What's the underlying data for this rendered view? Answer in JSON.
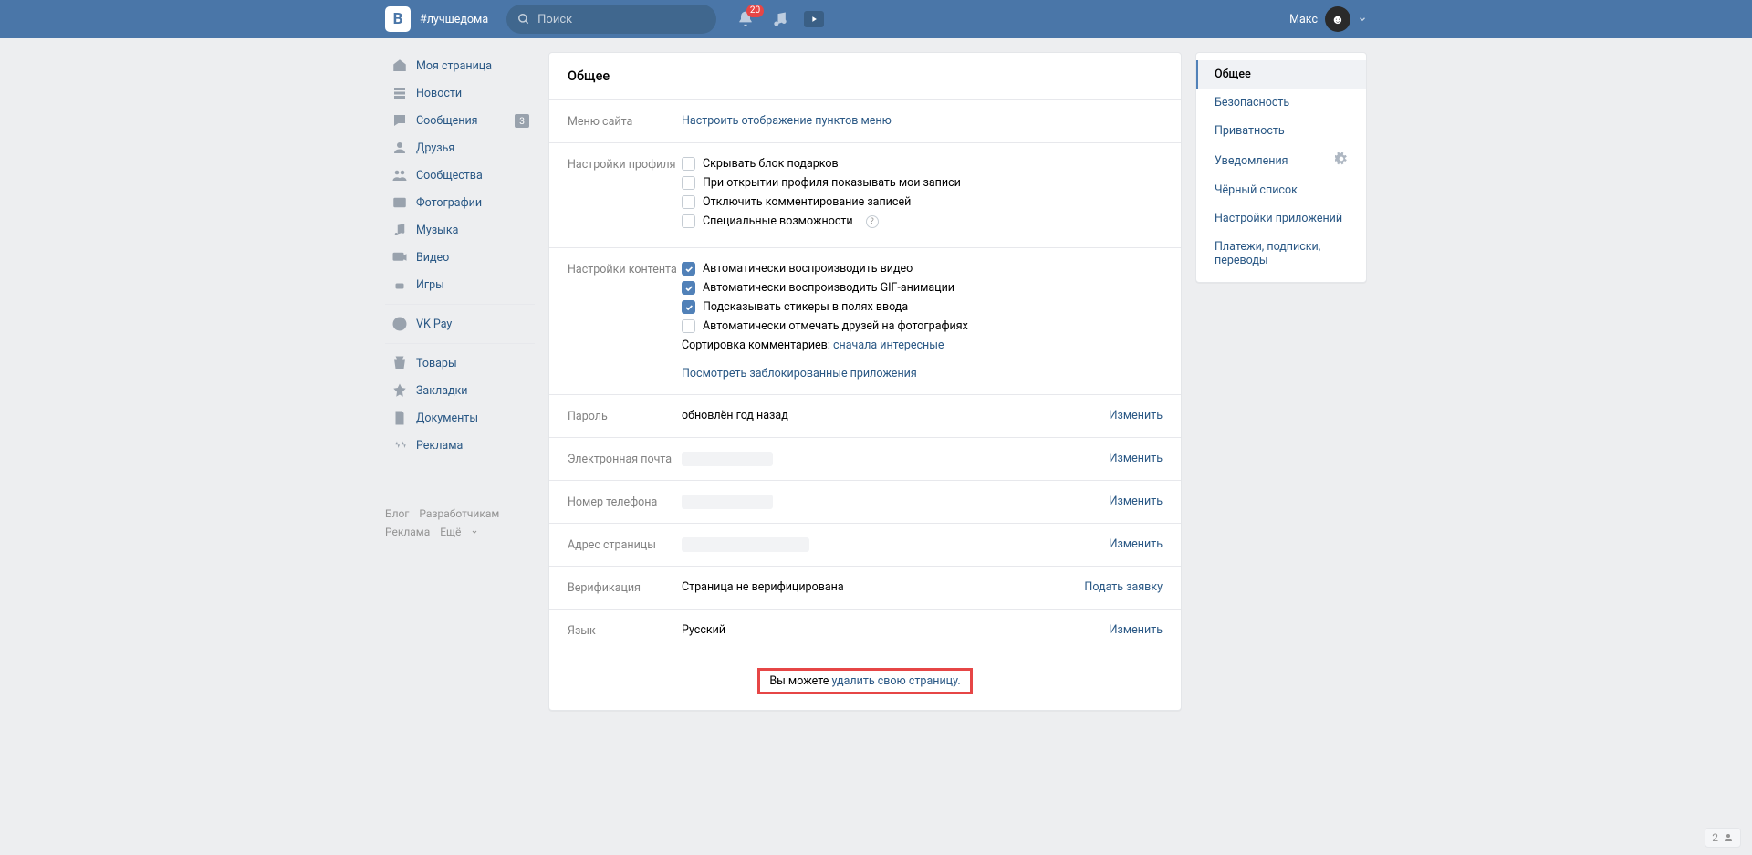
{
  "header": {
    "hashtag": "#лучшедома",
    "search_placeholder": "Поиск",
    "notif_count": "20",
    "username": "Макс"
  },
  "sidebar": {
    "items": [
      {
        "label": "Моя страница"
      },
      {
        "label": "Новости"
      },
      {
        "label": "Сообщения",
        "count": "3"
      },
      {
        "label": "Друзья"
      },
      {
        "label": "Сообщества"
      },
      {
        "label": "Фотографии"
      },
      {
        "label": "Музыка"
      },
      {
        "label": "Видео"
      },
      {
        "label": "Игры"
      }
    ],
    "vkpay": "VK Pay",
    "extra": [
      {
        "label": "Товары"
      },
      {
        "label": "Закладки"
      },
      {
        "label": "Документы"
      },
      {
        "label": "Реклама"
      }
    ],
    "footer": {
      "blog": "Блог",
      "devs": "Разработчикам",
      "ads": "Реклама",
      "more": "Ещё"
    }
  },
  "content": {
    "title": "Общее",
    "menu": {
      "label": "Меню сайта",
      "link": "Настроить отображение пунктов меню"
    },
    "profile": {
      "label": "Настройки профиля",
      "opts": [
        {
          "text": "Скрывать блок подарков",
          "checked": false
        },
        {
          "text": "При открытии профиля показывать мои записи",
          "checked": false
        },
        {
          "text": "Отключить комментирование записей",
          "checked": false
        },
        {
          "text": "Специальные возможности",
          "checked": false,
          "help": true
        }
      ]
    },
    "content_set": {
      "label": "Настройки контента",
      "opts": [
        {
          "text": "Автоматически воспроизводить видео",
          "checked": true
        },
        {
          "text": "Автоматически воспроизводить GIF-анимации",
          "checked": true
        },
        {
          "text": "Подсказывать стикеры в полях ввода",
          "checked": true
        },
        {
          "text": "Автоматически отмечать друзей на фотографиях",
          "checked": false
        }
      ],
      "sort_label": "Сортировка комментариев: ",
      "sort_value": "сначала интересные",
      "blocked": "Посмотреть заблокированные приложения"
    },
    "password": {
      "label": "Пароль",
      "value": "обновлён год назад",
      "action": "Изменить"
    },
    "email": {
      "label": "Электронная почта",
      "action": "Изменить"
    },
    "phone": {
      "label": "Номер телефона",
      "action": "Изменить"
    },
    "address": {
      "label": "Адрес страницы",
      "action": "Изменить"
    },
    "verify": {
      "label": "Верификация",
      "value": "Страница не верифицирована",
      "action": "Подать заявку"
    },
    "lang": {
      "label": "Язык",
      "value": "Русский",
      "action": "Изменить"
    },
    "delete": {
      "prefix": "Вы можете ",
      "link": "удалить свою страницу."
    }
  },
  "tabs": [
    {
      "label": "Общее",
      "active": true
    },
    {
      "label": "Безопасность"
    },
    {
      "label": "Приватность"
    },
    {
      "label": "Уведомления",
      "gear": true
    },
    {
      "label": "Чёрный список"
    },
    {
      "label": "Настройки приложений"
    },
    {
      "label": "Платежи, подписки, переводы"
    }
  ],
  "corner": "2"
}
